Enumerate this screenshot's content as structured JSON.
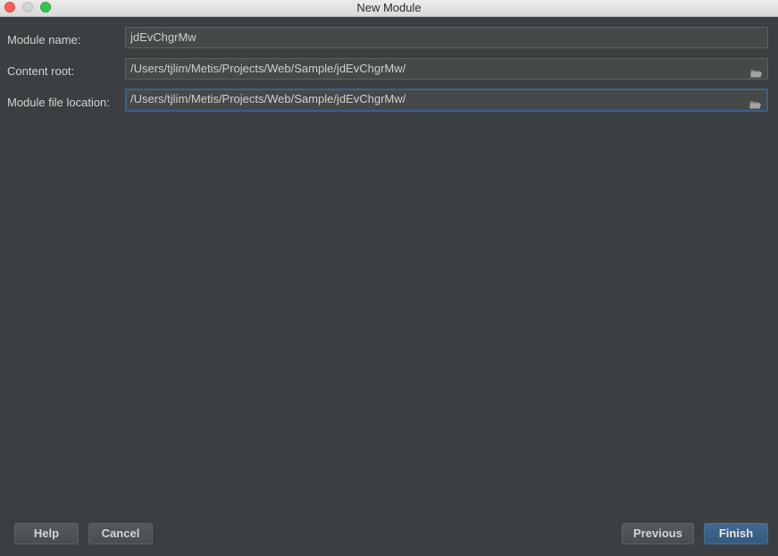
{
  "window": {
    "title": "New Module"
  },
  "form": {
    "module_name": {
      "label": "Module name:",
      "value": "jdEvChgrMw"
    },
    "content_root": {
      "label": "Content root:",
      "value": "/Users/tjlim/Metis/Projects/Web/Sample/jdEvChgrMw/",
      "icon": "folder-icon"
    },
    "module_file_location": {
      "label": "Module file location:",
      "value": "/Users/tjlim/Metis/Projects/Web/Sample/jdEvChgrMw/",
      "icon": "folder-icon"
    }
  },
  "buttons": {
    "help": "Help",
    "cancel": "Cancel",
    "previous": "Previous",
    "finish": "Finish"
  },
  "colors": {
    "background": "#3c3f41",
    "field_background": "#45494a",
    "focus_border": "#3d6185",
    "primary_button": "#365a7f"
  }
}
